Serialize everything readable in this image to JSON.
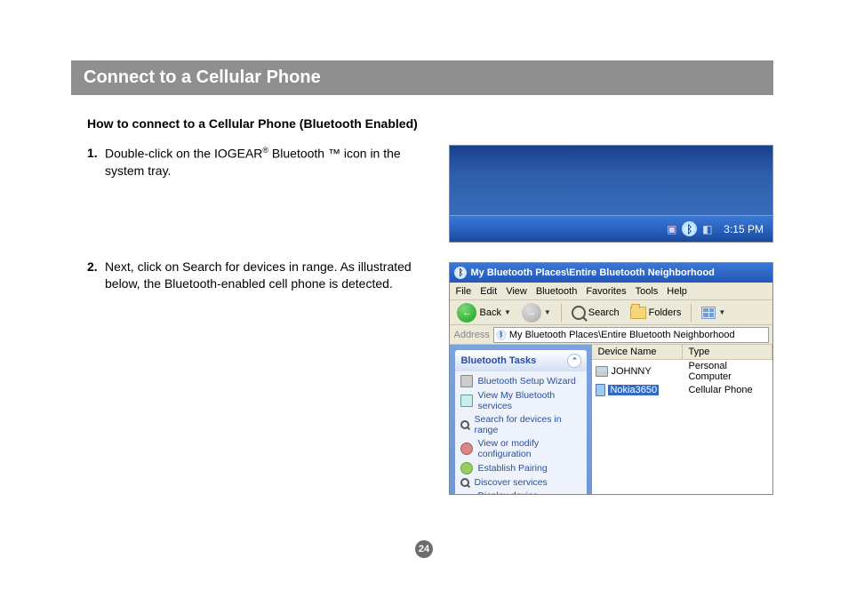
{
  "page_number": "24",
  "title": "Connect to a Cellular Phone",
  "subhead": "How to connect to a Cellular Phone (Bluetooth Enabled)",
  "steps": [
    {
      "num": "1.",
      "text_pre": "Double-click on the IOGEAR",
      "sup": "®",
      "text_post": " Bluetooth ™ icon in the system tray."
    },
    {
      "num": "2.",
      "text": "Next, click on Search for devices in range.  As illustrated below, the Bluetooth-enabled cell phone is detected."
    }
  ],
  "tray": {
    "clock": "3:15 PM"
  },
  "explorer": {
    "title": "My Bluetooth Places\\Entire Bluetooth Neighborhood",
    "menus": [
      "File",
      "Edit",
      "View",
      "Bluetooth",
      "Favorites",
      "Tools",
      "Help"
    ],
    "toolbar": {
      "back": "Back",
      "search": "Search",
      "folders": "Folders"
    },
    "address_label": "Address",
    "address_path": "My Bluetooth Places\\Entire Bluetooth Neighborhood",
    "tasks": {
      "head": "Bluetooth Tasks",
      "items": [
        "Bluetooth Setup Wizard",
        "View My Bluetooth services",
        "Search for devices in range",
        "View or modify configuration",
        "Establish Pairing",
        "Discover services",
        "Display device properties"
      ]
    },
    "columns": {
      "name": "Device Name",
      "type": "Type"
    },
    "rows": [
      {
        "name": "JOHNNY",
        "type": "Personal Computer",
        "selected": false,
        "kind": "pc"
      },
      {
        "name": "Nokia3650",
        "type": "Cellular Phone",
        "selected": true,
        "kind": "phone"
      }
    ]
  }
}
